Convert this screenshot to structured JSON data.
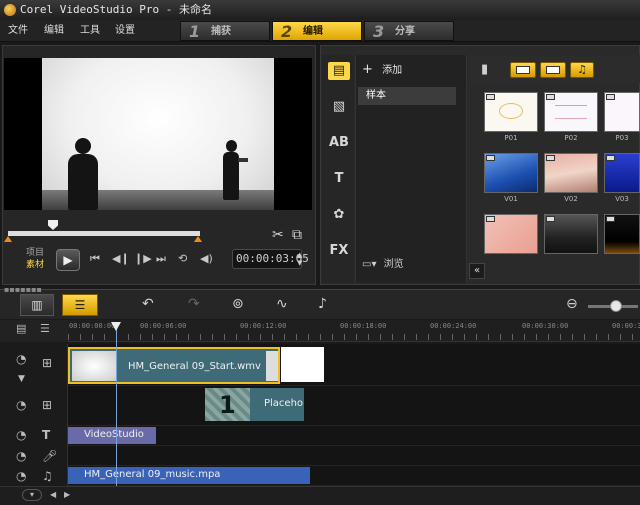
{
  "window": {
    "title": "Corel VideoStudio Pro - 未命名"
  },
  "menu": [
    "文件",
    "编辑",
    "工具",
    "设置"
  ],
  "steps": [
    {
      "num": "1",
      "label": "捕获",
      "active": false
    },
    {
      "num": "2",
      "label": "编辑",
      "active": true
    },
    {
      "num": "3",
      "label": "分享",
      "active": false
    }
  ],
  "preview": {
    "mode_project": "项目",
    "mode_clip": "素材",
    "timecode": "00:00:03:05",
    "cut_icon": "scissors-icon",
    "copy_icon": "copy-icon"
  },
  "library": {
    "add_label": "添加",
    "folder": "样本",
    "browse_label": "浏览",
    "collapse": "«",
    "categories": [
      "media-icon",
      "transition-icon",
      "title-icon",
      "graphics-icon",
      "filter-icon"
    ],
    "category_text": [
      "",
      "",
      "AB",
      "T",
      "",
      "FX"
    ],
    "thumbnails": [
      {
        "label": "P01"
      },
      {
        "label": "P02"
      },
      {
        "label": "P03"
      },
      {
        "label": "V01"
      },
      {
        "label": "V02"
      },
      {
        "label": "V03"
      },
      {
        "label": ""
      },
      {
        "label": ""
      },
      {
        "label": ""
      }
    ]
  },
  "timeline": {
    "ruler_ticks": [
      "00:00:00:00",
      "00:00:06:00",
      "00:00:12:00",
      "00:00:18:00",
      "00:00:24:00",
      "00:00:30:00",
      "00:00:3"
    ],
    "video_clip": "HM_General 09_Start.wmv",
    "overlay_clip": "Placeho",
    "overlay_number": "1",
    "title_clip": "VideoStudio",
    "music_clip": "HM_General 09_music.mpa"
  },
  "colors": {
    "accent": "#ffd84a",
    "music_track": "#3a63b8",
    "title_track": "#6a6aa8",
    "video_clip": "#3f6a78"
  }
}
